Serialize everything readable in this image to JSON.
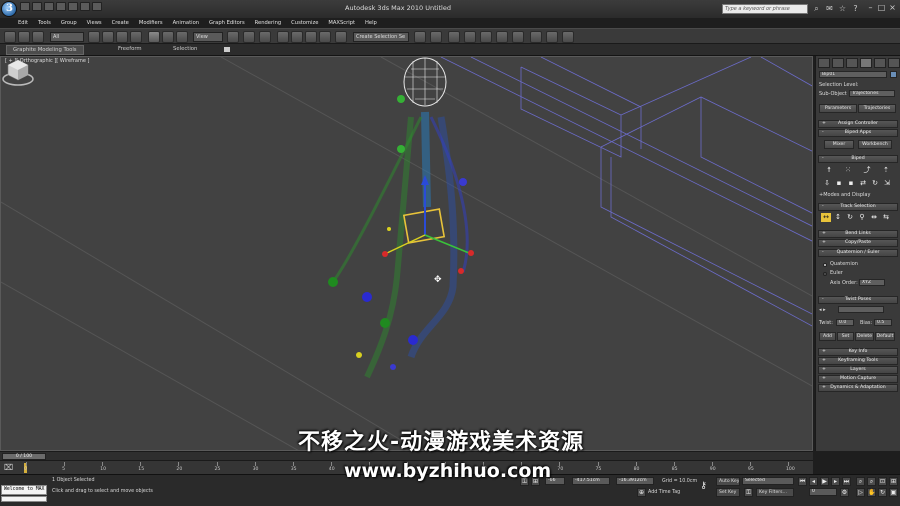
{
  "app": {
    "title": "Autodesk 3ds Max  2010    Untitled",
    "search_placeholder": "Type a keyword or phrase"
  },
  "menu": {
    "items": [
      "Edit",
      "Tools",
      "Group",
      "Views",
      "Create",
      "Modifiers",
      "Animation",
      "Graph Editors",
      "Rendering",
      "Customize",
      "MAXScript",
      "Help"
    ]
  },
  "toolbar": {
    "filter_dropdown": "All",
    "coord_dropdown": "View",
    "selection_set_dropdown": "Create Selection Se"
  },
  "ribbon": {
    "tabs": [
      "Graphite Modeling Tools",
      "Freeform",
      "Selection"
    ]
  },
  "viewport": {
    "label": "[ + ][ Orthographic ][ Wireframe ]"
  },
  "command_panel": {
    "object_name": "Bip01",
    "selection_level_label": "Selection Level:",
    "sub_object_label": "Sub-Object",
    "sub_object_value": "Trajectories",
    "parameters_btn": "Parameters",
    "trajectories_btn": "Trajectories",
    "assign_controller": "Assign Controller",
    "biped_apps": "Biped Apps",
    "mixer_btn": "Mixer",
    "workbench_btn": "Workbench",
    "biped": "Biped",
    "modes_display": "Modes and Display",
    "track_selection": "Track Selection",
    "bend_links": "Bend Links",
    "copy_paste": "Copy/Paste",
    "quaternion_euler": "Quaternion / Euler",
    "quaternion": "Quaternion",
    "euler": "Euler",
    "axis_order_label": "Axis Order:",
    "axis_order_value": "XYZ",
    "twist_poses": "Twist Poses",
    "twist_label": "Twist:",
    "twist_value": "0.0",
    "bias_label": "Bias:",
    "bias_value": "0.5",
    "add_btn": "Add",
    "set_btn": "Set",
    "delete_btn": "Delete",
    "default_btn": "Default",
    "key_info": "Key Info",
    "keyframing_tools": "Keyframing Tools",
    "layers": "Layers",
    "motion_capture": "Motion Capture",
    "dynamics_adaptation": "Dynamics & Adaptation",
    "expand_sign": "+",
    "collapse_sign": "-"
  },
  "timeline": {
    "frame_display": "0 / 100",
    "ticks": [
      "0",
      "5",
      "10",
      "15",
      "20",
      "25",
      "30",
      "35",
      "40",
      "45",
      "50",
      "55",
      "60",
      "65",
      "70",
      "75",
      "80",
      "85",
      "90",
      "95",
      "100"
    ]
  },
  "status": {
    "maxscript_text": "Welcome to MAX",
    "objects_selected": "1 Object Selected",
    "prompt": "Click and drag to select and move objects",
    "x_value": "-66",
    "y_value": "-417.51cm",
    "z_value": "-16.3912cm",
    "grid": "Grid = 10.0cm",
    "add_time_tag": "Add Time Tag",
    "auto_key": "Auto Key",
    "selected_dropdown": "Selected",
    "set_key": "Set Key",
    "key_filters": "Key Filters...",
    "frame_field": "0"
  },
  "watermark": {
    "line1": "不移之火-动漫游戏美术资源",
    "line2": "www.byzhihuo.com"
  },
  "colors": {
    "viewport_bg": "#424242",
    "panel_bg": "#3a3a3a",
    "accent_yellow": "#e8c33a"
  }
}
